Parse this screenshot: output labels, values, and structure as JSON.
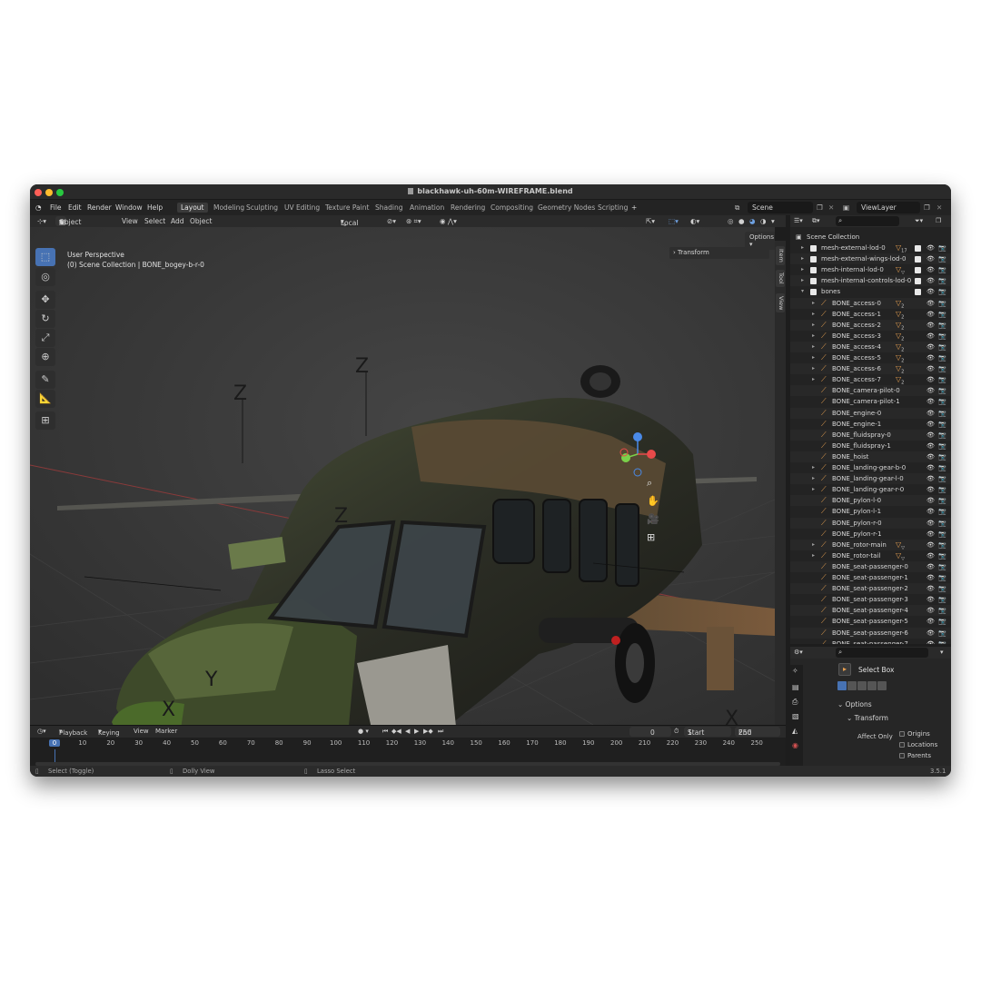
{
  "window": {
    "title": "blackhawk-uh-60m-WIREFRAME.blend"
  },
  "menu": {
    "items": [
      "File",
      "Edit",
      "Render",
      "Window",
      "Help"
    ]
  },
  "workspaces": [
    {
      "label": "Layout",
      "active": true
    },
    {
      "label": "Modeling"
    },
    {
      "label": "Sculpting"
    },
    {
      "label": "UV Editing"
    },
    {
      "label": "Texture Paint"
    },
    {
      "label": "Shading"
    },
    {
      "label": "Animation"
    },
    {
      "label": "Rendering"
    },
    {
      "label": "Compositing"
    },
    {
      "label": "Geometry Nodes"
    },
    {
      "label": "Scripting"
    }
  ],
  "add_workspace": "+",
  "scene": {
    "name": "Scene",
    "view_layer": "ViewLayer"
  },
  "viewport_header": {
    "mode": "Object Mode",
    "menus": [
      "View",
      "Select",
      "Add",
      "Object"
    ],
    "orientation": "Local",
    "options": "Options"
  },
  "viewport": {
    "perspective": "User Perspective",
    "collection_info": "(0) Scene Collection | BONE_bogey-b-r-0",
    "transform_panel": "Transform"
  },
  "n_tabs": [
    "Item",
    "Tool",
    "View"
  ],
  "timeline": {
    "menus": [
      "Playback",
      "Keying",
      "View",
      "Marker"
    ],
    "current_frame": "0",
    "start_label": "Start",
    "start_value": "1",
    "end_label": "End",
    "end_value": "250",
    "ticks": [
      "0",
      "10",
      "20",
      "30",
      "40",
      "50",
      "60",
      "70",
      "80",
      "90",
      "100",
      "110",
      "120",
      "130",
      "140",
      "150",
      "160",
      "170",
      "180",
      "190",
      "200",
      "210",
      "220",
      "230",
      "240",
      "250"
    ]
  },
  "status_bar": {
    "left": "Select (Toggle)",
    "middle": "Dolly View",
    "right": "Lasso Select",
    "version": "3.5.1"
  },
  "outliner": {
    "root": "Scene Collection",
    "rows": [
      {
        "label": "mesh-external-lod-0",
        "level": 1,
        "type": "collection",
        "expand": "right",
        "badge": "17",
        "check": true
      },
      {
        "label": "mesh-external-wings-lod-0",
        "level": 1,
        "type": "collection",
        "expand": "right",
        "badge": "",
        "check": true
      },
      {
        "label": "mesh-internal-lod-0",
        "level": 1,
        "type": "collection",
        "expand": "right",
        "badge": "▽",
        "check": true
      },
      {
        "label": "mesh-internal-controls-lod-0",
        "level": 1,
        "type": "collection",
        "expand": "right",
        "badge": "",
        "check": true
      },
      {
        "label": "bones",
        "level": 1,
        "type": "collection",
        "expand": "down",
        "badge": "",
        "check": true
      },
      {
        "label": "BONE_access-0",
        "level": 2,
        "type": "bone",
        "expand": "right",
        "badge": "2"
      },
      {
        "label": "BONE_access-1",
        "level": 2,
        "type": "bone",
        "expand": "right",
        "badge": "2"
      },
      {
        "label": "BONE_access-2",
        "level": 2,
        "type": "bone",
        "expand": "right",
        "badge": "2"
      },
      {
        "label": "BONE_access-3",
        "level": 2,
        "type": "bone",
        "expand": "right",
        "badge": "2"
      },
      {
        "label": "BONE_access-4",
        "level": 2,
        "type": "bone",
        "expand": "right",
        "badge": "2"
      },
      {
        "label": "BONE_access-5",
        "level": 2,
        "type": "bone",
        "expand": "right",
        "badge": "2"
      },
      {
        "label": "BONE_access-6",
        "level": 2,
        "type": "bone",
        "expand": "right",
        "badge": "2"
      },
      {
        "label": "BONE_access-7",
        "level": 2,
        "type": "bone",
        "expand": "right",
        "badge": "2"
      },
      {
        "label": "BONE_camera-pilot-0",
        "level": 2,
        "type": "bone",
        "expand": "",
        "badge": ""
      },
      {
        "label": "BONE_camera-pilot-1",
        "level": 2,
        "type": "bone",
        "expand": "",
        "badge": ""
      },
      {
        "label": "BONE_engine-0",
        "level": 2,
        "type": "bone",
        "expand": "",
        "badge": ""
      },
      {
        "label": "BONE_engine-1",
        "level": 2,
        "type": "bone",
        "expand": "",
        "badge": ""
      },
      {
        "label": "BONE_fluidspray-0",
        "level": 2,
        "type": "bone",
        "expand": "",
        "badge": ""
      },
      {
        "label": "BONE_fluidspray-1",
        "level": 2,
        "type": "bone",
        "expand": "",
        "badge": ""
      },
      {
        "label": "BONE_hoist",
        "level": 2,
        "type": "bone",
        "expand": "",
        "badge": ""
      },
      {
        "label": "BONE_landing-gear-b-0",
        "level": 2,
        "type": "bone",
        "expand": "right",
        "badge": ""
      },
      {
        "label": "BONE_landing-gear-l-0",
        "level": 2,
        "type": "bone",
        "expand": "right",
        "badge": ""
      },
      {
        "label": "BONE_landing-gear-r-0",
        "level": 2,
        "type": "bone",
        "expand": "right",
        "badge": ""
      },
      {
        "label": "BONE_pylon-l-0",
        "level": 2,
        "type": "bone",
        "expand": "",
        "badge": ""
      },
      {
        "label": "BONE_pylon-l-1",
        "level": 2,
        "type": "bone",
        "expand": "",
        "badge": ""
      },
      {
        "label": "BONE_pylon-r-0",
        "level": 2,
        "type": "bone",
        "expand": "",
        "badge": ""
      },
      {
        "label": "BONE_pylon-r-1",
        "level": 2,
        "type": "bone",
        "expand": "",
        "badge": ""
      },
      {
        "label": "BONE_rotor-main",
        "level": 2,
        "type": "bone",
        "expand": "right",
        "badge": "▽"
      },
      {
        "label": "BONE_rotor-tail",
        "level": 2,
        "type": "bone",
        "expand": "right",
        "badge": "▽"
      },
      {
        "label": "BONE_seat-passenger-0",
        "level": 2,
        "type": "bone",
        "expand": "",
        "badge": ""
      },
      {
        "label": "BONE_seat-passenger-1",
        "level": 2,
        "type": "bone",
        "expand": "",
        "badge": ""
      },
      {
        "label": "BONE_seat-passenger-2",
        "level": 2,
        "type": "bone",
        "expand": "",
        "badge": ""
      },
      {
        "label": "BONE_seat-passenger-3",
        "level": 2,
        "type": "bone",
        "expand": "",
        "badge": ""
      },
      {
        "label": "BONE_seat-passenger-4",
        "level": 2,
        "type": "bone",
        "expand": "",
        "badge": ""
      },
      {
        "label": "BONE_seat-passenger-5",
        "level": 2,
        "type": "bone",
        "expand": "",
        "badge": ""
      },
      {
        "label": "BONE_seat-passenger-6",
        "level": 2,
        "type": "bone",
        "expand": "",
        "badge": ""
      },
      {
        "label": "BONE_seat-passenger-7",
        "level": 2,
        "type": "bone",
        "expand": "",
        "badge": ""
      }
    ]
  },
  "properties": {
    "tool_name": "Select Box",
    "options_label": "Options",
    "transform_label": "Transform",
    "affect_only_label": "Affect Only",
    "checkboxes": [
      "Origins",
      "Locations",
      "Parents"
    ]
  },
  "colors": {
    "accent": "#4772b3",
    "bone_orange": "#e8a050",
    "viewport_bg": "#3a3a3a"
  }
}
